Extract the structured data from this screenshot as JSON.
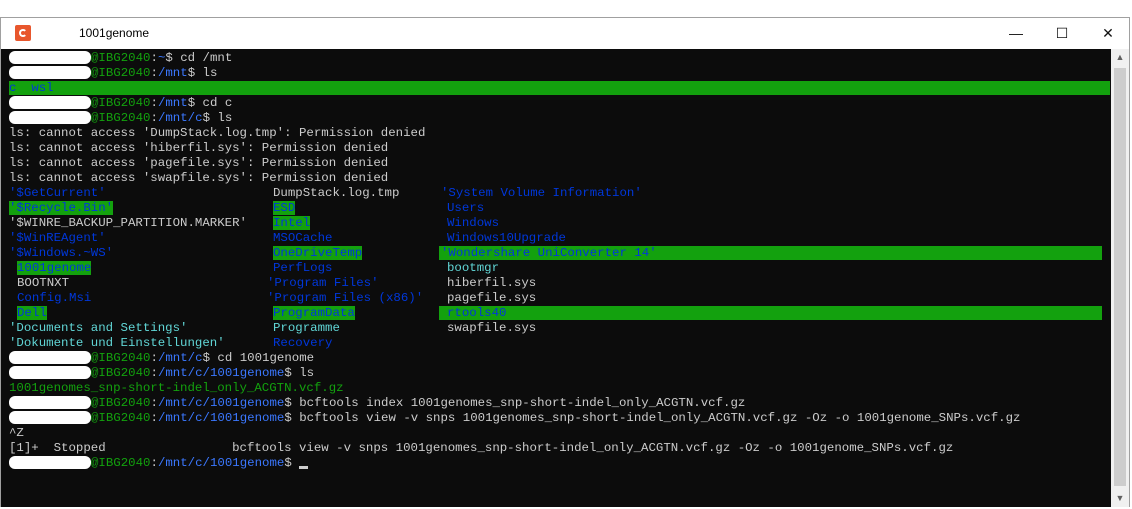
{
  "window": {
    "title": "1001genome",
    "min": "—",
    "max": "☐",
    "close": "✕"
  },
  "prompt_host": "@IBG2040",
  "lines": {
    "l1_path": "~",
    "l1_cmd": "$ cd /mnt",
    "l2_path": "/mnt",
    "l2_cmd": "$ ls",
    "l3_a": "c",
    "l3_b": "wsl",
    "l4_path": "/mnt",
    "l4_cmd": "$ cd c",
    "l5_path": "/mnt/c",
    "l5_cmd": "$ ls",
    "err1": "ls: cannot access 'DumpStack.log.tmp': Permission denied",
    "err2": "ls: cannot access 'hiberfil.sys': Permission denied",
    "err3": "ls: cannot access 'pagefile.sys': Permission denied",
    "err4": "ls: cannot access 'swapfile.sys': Permission denied",
    "cd_path": "/mnt/c",
    "cd_cmd": "$ cd 1001genome",
    "ls_path": "/mnt/c/1001genome",
    "ls_cmd": "$ ls",
    "file1": "1001genomes_snp-short-indel_only_ACGTN.vcf.gz",
    "idx_path": "/mnt/c/1001genome",
    "idx_cmd": "$ bcftools index 1001genomes_snp-short-indel_only_ACGTN.vcf.gz",
    "view_path": "/mnt/c/1001genome",
    "view_cmd": "$ bcftools view -v snps 1001genomes_snp-short-indel_only_ACGTN.vcf.gz -Oz -o 1001genome_SNPs.vcf.gz",
    "ctrlz": "^Z",
    "job": "[1]+  Stopped                 bcftools view -v snps 1001genomes_snp-short-indel_only_ACGTN.vcf.gz -Oz -o 1001genome_SNPs.vcf.gz",
    "last_path": "/mnt/c/1001genome",
    "last_cmd": "$ "
  },
  "listing": {
    "col1": [
      "'$GetCurrent'",
      "'$Recycle.Bin'",
      "'$WINRE_BACKUP_PARTITION.MARKER'",
      "'$WinREAgent'",
      "'$Windows.~WS'",
      "1001genome",
      "BOOTNXT",
      "Config.Msi",
      "Dell",
      "'Documents and Settings'",
      "'Dokumente und Einstellungen'"
    ],
    "col2": [
      "DumpStack.log.tmp",
      "ESD",
      "Intel",
      "MSOCache",
      "OneDriveTemp",
      "PerfLogs",
      "'Program Files'",
      "'Program Files (x86)'",
      "ProgramData",
      "Programme",
      "Recovery"
    ],
    "col3": [
      "'System Volume Information'",
      "Users",
      "Windows",
      "Windows10Upgrade",
      "'Wondershare UniConverter 14'",
      "bootmgr",
      "hiberfil.sys",
      "pagefile.sys",
      "rtools40",
      "swapfile.sys"
    ]
  },
  "colors": {
    "green": "#13a10e",
    "blue": "#3b78ff",
    "cyan": "#61d6d6",
    "gray": "#cccccc"
  }
}
